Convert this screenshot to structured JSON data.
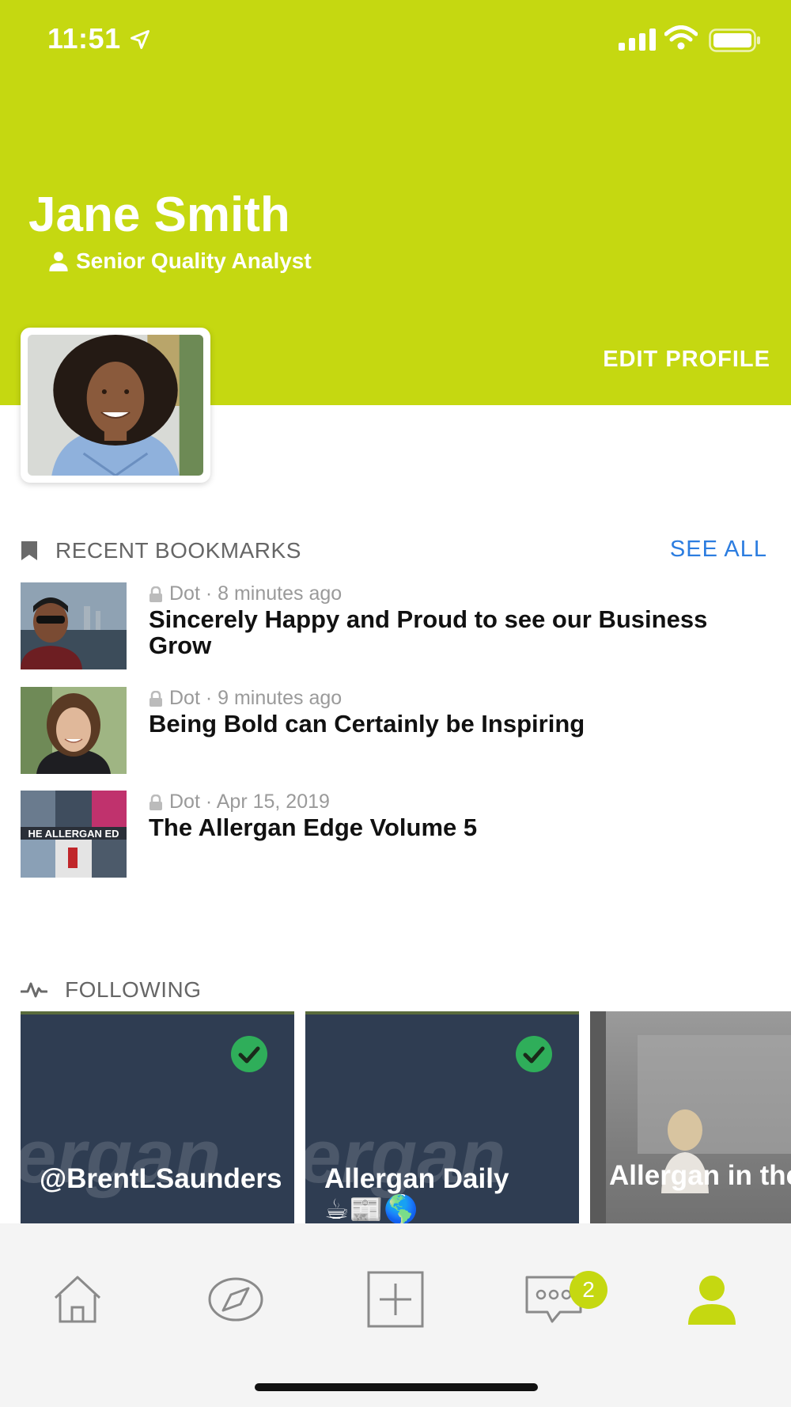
{
  "status_bar": {
    "time": "11:51",
    "icons": [
      "location-arrow-icon",
      "cellular-signal-icon",
      "wifi-icon",
      "battery-icon"
    ]
  },
  "profile": {
    "name": "Jane Smith",
    "role": "Senior Quality Analyst",
    "edit_label": "EDIT PROFILE",
    "header_color": "#c5d811"
  },
  "bookmarks": {
    "label": "RECENT BOOKMARKS",
    "see_all": "SEE ALL",
    "items": [
      {
        "meta": "Dot · 8 minutes ago",
        "title": "Sincerely Happy and Proud to see our Business Grow"
      },
      {
        "meta": "Dot · 9 minutes ago",
        "title": "Being Bold can Certainly be Inspiring"
      },
      {
        "meta": "Dot · Apr 15, 2019",
        "title": "The Allergan Edge Volume 5",
        "thumb_text": "HE ALLERGAN ED"
      }
    ]
  },
  "following": {
    "label": "FOLLOWING",
    "cards": [
      {
        "title": "@BrentLSaunders",
        "bg_word": "ergan",
        "followed": true
      },
      {
        "title": "Allergan Daily",
        "emoji": "☕📰🌎",
        "bg_word": "ergan",
        "followed": true
      },
      {
        "title": "Allergan in the Media",
        "emoji": "📰📺",
        "followed": false
      }
    ]
  },
  "tab_bar": {
    "items": [
      "home-icon",
      "compass-icon",
      "add-post-icon",
      "messages-icon",
      "profile-icon"
    ],
    "active": "profile-icon",
    "messages_badge": "2",
    "accent": "#c5d811"
  }
}
